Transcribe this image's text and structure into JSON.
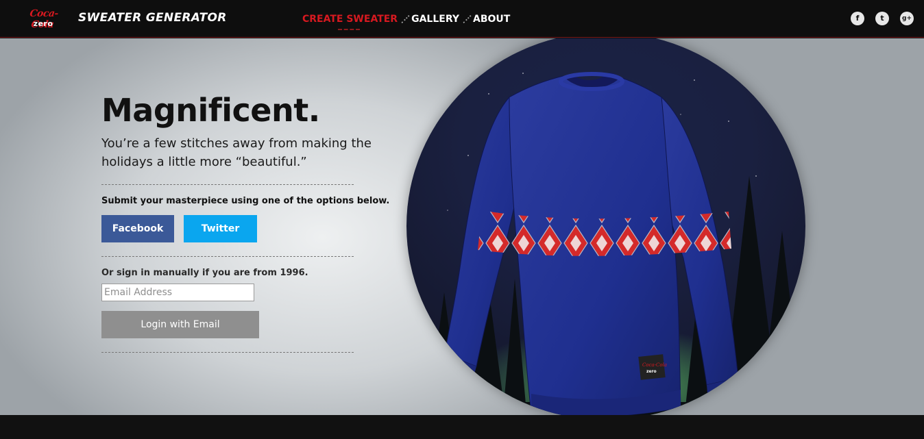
{
  "header": {
    "logo": {
      "script": "Coca-Cola",
      "sub": "zero"
    },
    "title": "SWEATER GENERATOR",
    "nav": [
      {
        "label": "CREATE SWEATER",
        "active": true
      },
      {
        "label": "GALLERY",
        "active": false
      },
      {
        "label": "ABOUT",
        "active": false
      }
    ],
    "social": [
      {
        "icon": "facebook-icon",
        "glyph": "f"
      },
      {
        "icon": "twitter-icon",
        "glyph": "t"
      },
      {
        "icon": "google-plus-icon",
        "glyph": "g+"
      }
    ]
  },
  "hero": {
    "headline": "Magnificent.",
    "subhead": "You’re a few stitches away from making the holidays a little more “beautiful.”",
    "submit_prompt": "Submit your masterpiece using one of the options below.",
    "facebook_label": "Facebook",
    "twitter_label": "Twitter",
    "manual_prompt": "Or sign in manually if you are from 1996.",
    "email_placeholder": "Email Address",
    "login_label": "Login with Email"
  },
  "sweater": {
    "image": "knit-sweater-illustration",
    "body_color": "#1f2f8f",
    "pattern_color": "#d42a2a",
    "tag": {
      "script": "Coca-Cola",
      "sub": "zero"
    }
  },
  "colors": {
    "accent": "#d71920",
    "facebook": "#3b5998",
    "twitter": "#0aa6ef",
    "login": "#8f8f8f"
  }
}
